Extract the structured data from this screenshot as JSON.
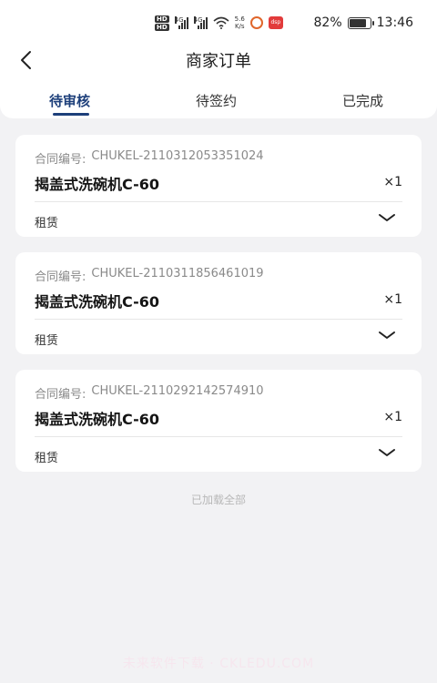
{
  "status_bar": {
    "hd_badges": [
      "HD",
      "HD"
    ],
    "network_labels": [
      "4G",
      "4G"
    ],
    "net_speed_value": "5.6",
    "net_speed_unit": "K/s",
    "app_icon_label": "dsp",
    "battery_percent": "82%",
    "battery_level": 0.82,
    "time": "13:46"
  },
  "header": {
    "title": "商家订单",
    "back_icon": "chevron-left-icon"
  },
  "tabs": [
    {
      "label": "待审核",
      "active": true
    },
    {
      "label": "待签约",
      "active": false
    },
    {
      "label": "已完成",
      "active": false
    }
  ],
  "orders": [
    {
      "contract_label": "合同编号:",
      "contract_no": "CHUKEL-2110312053351024",
      "product": "揭盖式洗碗机C-60",
      "quantity": "×1",
      "rent_type": "租赁"
    },
    {
      "contract_label": "合同编号:",
      "contract_no": "CHUKEL-2110311856461019",
      "product": "揭盖式洗碗机C-60",
      "quantity": "×1",
      "rent_type": "租赁"
    },
    {
      "contract_label": "合同编号:",
      "contract_no": "CHUKEL-2110292142574910",
      "product": "揭盖式洗碗机C-60",
      "quantity": "×1",
      "rent_type": "租赁"
    }
  ],
  "footer_note": "已加载全部",
  "watermark": "未来软件下载 · CKLEDU.COM",
  "colors": {
    "accent": "#1d3f7a",
    "background": "#f2f2f4",
    "card": "#ffffff",
    "muted_text": "#8a8a8a"
  }
}
